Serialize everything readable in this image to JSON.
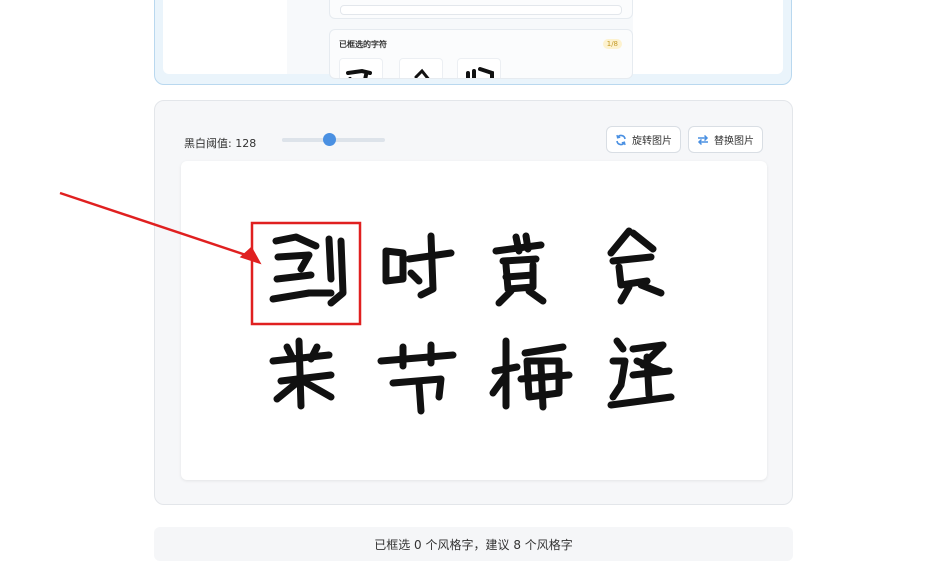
{
  "top_panel": {
    "selected_title": "已框选的字符",
    "selected_count": "1/8"
  },
  "toolbar": {
    "threshold_label": "黑白阈值: 128",
    "threshold_value": 128,
    "threshold_max": 255,
    "rotate_label": "旋转图片",
    "replace_label": "替换图片"
  },
  "icons": {
    "rotate": "rotate-icon",
    "replace": "swap-icon",
    "arrow": "red-arrow-annotation"
  },
  "colors": {
    "accent": "#4a90e2",
    "annotation": "#e02020",
    "ink": "#111111"
  },
  "status": {
    "text": "已框选 0 个风格字，建议 8 个风格字"
  }
}
